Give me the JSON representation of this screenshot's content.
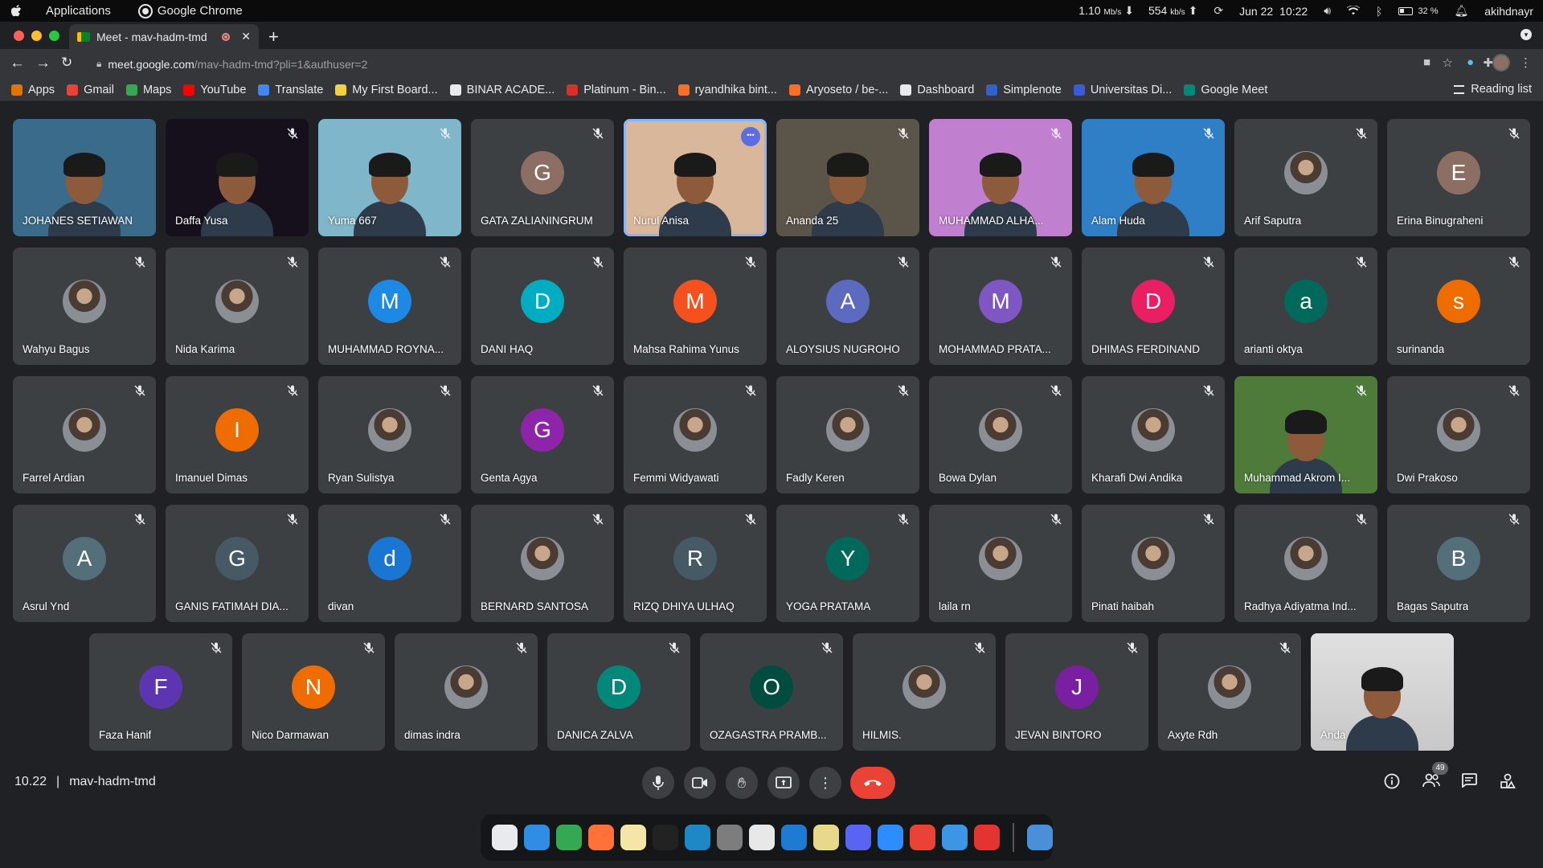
{
  "os": {
    "apple": "",
    "applications": "Applications",
    "chrome_label": "Google Chrome",
    "net_down": "1.10",
    "net_down_unit": "Mb/s",
    "net_up": "554",
    "net_up_unit": "kb/s",
    "date": "Jun 22",
    "time": "10:22",
    "battery": "32 %",
    "user": "akihdnayr"
  },
  "browser": {
    "tab_title": "Meet - mav-hadm-tmd",
    "url_host": "meet.google.com",
    "url_path": "/mav-hadm-tmd?pli=1&authuser=2",
    "bookmarks": [
      {
        "label": "Apps",
        "color": "#e37400",
        "icon": "apps-grid-icon"
      },
      {
        "label": "Gmail",
        "color": "#ea4335",
        "icon": "gmail-icon"
      },
      {
        "label": "Maps",
        "color": "#34a853",
        "icon": "maps-icon"
      },
      {
        "label": "YouTube",
        "color": "#ff0000",
        "icon": "youtube-icon"
      },
      {
        "label": "Translate",
        "color": "#4285f4",
        "icon": "translate-icon"
      },
      {
        "label": "My First Board...",
        "color": "#f4d03f",
        "icon": "miro-icon"
      },
      {
        "label": "BINAR ACADE...",
        "color": "#e8eaed",
        "icon": "binar-icon"
      },
      {
        "label": "Platinum - Bin...",
        "color": "#d93025",
        "icon": "platinum-icon"
      },
      {
        "label": "ryandhika bint...",
        "color": "#fc6d26",
        "icon": "gitlab-icon"
      },
      {
        "label": "Aryoseto / be-...",
        "color": "#fc6d26",
        "icon": "gitlab-icon"
      },
      {
        "label": "Dashboard",
        "color": "#e8eaed",
        "icon": "dashboard-icon"
      },
      {
        "label": "Simplenote",
        "color": "#3361cc",
        "icon": "simplenote-icon"
      },
      {
        "label": "Universitas Di...",
        "color": "#3b5bdb",
        "icon": "university-icon"
      },
      {
        "label": "Google Meet",
        "color": "#00897b",
        "icon": "meet-icon"
      }
    ],
    "reading_list": "Reading list"
  },
  "meet": {
    "participants": [
      {
        "name": "JOHANES SETIAWAN",
        "kind": "video",
        "bg": "#3a6b8a"
      },
      {
        "name": "Daffa Yusa",
        "kind": "video",
        "bg": "#15101c"
      },
      {
        "name": "Yuma 667",
        "kind": "video",
        "bg": "#7fb6c9"
      },
      {
        "name": "GATA ZALIANINGRUM",
        "kind": "letter",
        "letter": "G",
        "bg": "#8d6e63"
      },
      {
        "name": "Nurul Anisa",
        "kind": "video",
        "bg": "#d9b79a",
        "active": true
      },
      {
        "name": "Ananda 25",
        "kind": "video",
        "bg": "#5a5548"
      },
      {
        "name": "MUHAMMAD ALHA...",
        "kind": "video",
        "bg": "#c07fcf"
      },
      {
        "name": "Alam Huda",
        "kind": "video",
        "bg": "#2f7fc7"
      },
      {
        "name": "Arif Saputra",
        "kind": "photo",
        "bg": "#9aa0a6"
      },
      {
        "name": "Erina Binugraheni",
        "kind": "letter",
        "letter": "E",
        "bg": "#8d6e63"
      },
      {
        "name": "Wahyu Bagus",
        "kind": "photo",
        "bg": "#6a4fb0"
      },
      {
        "name": "Nida Karima",
        "kind": "photo",
        "bg": "#bdbdbd"
      },
      {
        "name": "MUHAMMAD ROYNA...",
        "kind": "letter",
        "letter": "M",
        "bg": "#1e88e5"
      },
      {
        "name": "DANI HAQ",
        "kind": "letter",
        "letter": "D",
        "bg": "#00acc1"
      },
      {
        "name": "Mahsa Rahima Yunus",
        "kind": "letter",
        "letter": "M",
        "bg": "#f4511e"
      },
      {
        "name": "ALOYSIUS NUGROHO",
        "kind": "letter",
        "letter": "A",
        "bg": "#5c6bc0"
      },
      {
        "name": "MOHAMMAD PRATA...",
        "kind": "letter",
        "letter": "M",
        "bg": "#7e57c2"
      },
      {
        "name": "DHIMAS FERDINAND",
        "kind": "letter",
        "letter": "D",
        "bg": "#e91e63"
      },
      {
        "name": "arianti oktya",
        "kind": "letter",
        "letter": "a",
        "bg": "#00695c"
      },
      {
        "name": "surinanda",
        "kind": "letter",
        "letter": "s",
        "bg": "#ef6c00"
      },
      {
        "name": "Farrel Ardian",
        "kind": "photo",
        "bg": "#8c6d4f"
      },
      {
        "name": "Imanuel Dimas",
        "kind": "letter",
        "letter": "I",
        "bg": "#ef6c00"
      },
      {
        "name": "Ryan Sulistya",
        "kind": "photo",
        "bg": "#4b3a38"
      },
      {
        "name": "Genta Agya",
        "kind": "letter",
        "letter": "G",
        "bg": "#8e24aa"
      },
      {
        "name": "Femmi Widyawati",
        "kind": "photo",
        "bg": "#8fa58a"
      },
      {
        "name": "Fadly Keren",
        "kind": "photo",
        "bg": "#b7922c"
      },
      {
        "name": "Bowa Dylan",
        "kind": "photo",
        "bg": "#4a5560"
      },
      {
        "name": "Kharafi Dwi Andika",
        "kind": "photo",
        "bg": "#5f8f6a"
      },
      {
        "name": "Muhammad Akrom I...",
        "kind": "video",
        "bg": "#4e7a3a"
      },
      {
        "name": "Dwi Prakoso",
        "kind": "photo",
        "bg": "#c0a48a"
      },
      {
        "name": "Asrul Ynd",
        "kind": "letter",
        "letter": "A",
        "bg": "#546e7a"
      },
      {
        "name": "GANIS FATIMAH DIA...",
        "kind": "letter",
        "letter": "G",
        "bg": "#455a64"
      },
      {
        "name": "divan",
        "kind": "letter",
        "letter": "d",
        "bg": "#1976d2"
      },
      {
        "name": "BERNARD SANTOSA",
        "kind": "photo",
        "bg": "#7a8d6a"
      },
      {
        "name": "RIZQ DHIYA ULHAQ",
        "kind": "letter",
        "letter": "R",
        "bg": "#455a64"
      },
      {
        "name": "YOGA PRATAMA",
        "kind": "letter",
        "letter": "Y",
        "bg": "#00695c"
      },
      {
        "name": "laila rn",
        "kind": "photo",
        "bg": "#c9a9b0"
      },
      {
        "name": "Pinati haibah",
        "kind": "photo",
        "bg": "#2e3a2a"
      },
      {
        "name": "Radhya Adiyatma Ind...",
        "kind": "photo",
        "bg": "#3b4a3a"
      },
      {
        "name": "Bagas Saputra",
        "kind": "letter",
        "letter": "B",
        "bg": "#546e7a"
      },
      {
        "name": "Faza Hanif",
        "kind": "letter",
        "letter": "F",
        "bg": "#5e35b1"
      },
      {
        "name": "Nico Darmawan",
        "kind": "letter",
        "letter": "N",
        "bg": "#ef6c00"
      },
      {
        "name": "dimas indra",
        "kind": "photo",
        "bg": "#6d4c41"
      },
      {
        "name": "DANICA ZALVA",
        "kind": "letter",
        "letter": "D",
        "bg": "#00897b"
      },
      {
        "name": "OZAGASTRA PRAMB...",
        "kind": "letter",
        "letter": "O",
        "bg": "#004d40"
      },
      {
        "name": "HILMIS.",
        "kind": "photo",
        "bg": "#bf4a2a"
      },
      {
        "name": "JEVAN BINTORO",
        "kind": "letter",
        "letter": "J",
        "bg": "#7b1fa2"
      },
      {
        "name": "Axyte Rdh",
        "kind": "photo",
        "bg": "#5ab0c0"
      },
      {
        "name": "Anda",
        "kind": "video",
        "bg": "#d8d8d8",
        "self": true
      }
    ],
    "time": "10.22",
    "separator": "|",
    "meeting_code": "mav-hadm-tmd",
    "participant_count": "49"
  },
  "dock": [
    {
      "name": "app-grid-icon",
      "color": "#e8eaed"
    },
    {
      "name": "finder-icon",
      "color": "#2f8de4"
    },
    {
      "name": "chrome-icon",
      "color": "#34a853"
    },
    {
      "name": "firefox-icon",
      "color": "#ff7139"
    },
    {
      "name": "notes-icon",
      "color": "#f5e6a8"
    },
    {
      "name": "terminal-icon",
      "color": "#222222"
    },
    {
      "name": "browser-icon",
      "color": "#1e88c7"
    },
    {
      "name": "settings-icon",
      "color": "#7d7d7d"
    },
    {
      "name": "ms-edge-icon",
      "color": "#e8e8e8"
    },
    {
      "name": "vscode-icon",
      "color": "#1f7ad4"
    },
    {
      "name": "stickies-icon",
      "color": "#e8d98a"
    },
    {
      "name": "discord-icon",
      "color": "#5865f2"
    },
    {
      "name": "zoom-icon",
      "color": "#2d8cff"
    },
    {
      "name": "chrome-alt-icon",
      "color": "#ea4335"
    },
    {
      "name": "finder-alt-icon",
      "color": "#3d95e6"
    },
    {
      "name": "acrobat-icon",
      "color": "#e3342f"
    },
    {
      "name": "files-icon",
      "color": "#4a90d9"
    }
  ]
}
